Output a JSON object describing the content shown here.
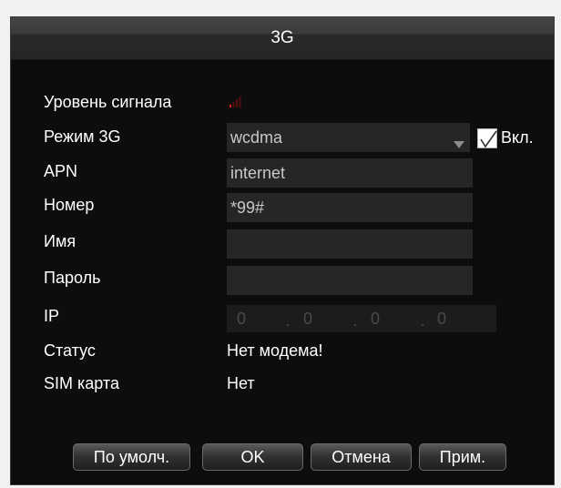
{
  "dialog": {
    "title": "3G"
  },
  "fields": {
    "signal_level": {
      "label": "Уровень сигнала",
      "icon": "signal-strength-icon",
      "level_bars_active": 1,
      "level_bars_total": 4,
      "color_active": "#e02020"
    },
    "mode_3g": {
      "label": "Режим 3G",
      "value": "wcdma",
      "enabled_label": "Вкл.",
      "enabled": true
    },
    "apn": {
      "label": "APN",
      "value": "internet"
    },
    "number": {
      "label": "Номер",
      "value": "*99#"
    },
    "name": {
      "label": "Имя",
      "value": ""
    },
    "password": {
      "label": "Пароль",
      "value": ""
    },
    "ip": {
      "label": "IP",
      "octets": [
        "0",
        "0",
        "0",
        "0"
      ],
      "separator": "."
    },
    "status": {
      "label": "Статус",
      "value": "Нет модема!"
    },
    "sim_card": {
      "label": "SIM карта",
      "value": "Нет"
    }
  },
  "buttons": {
    "default": "По умолч.",
    "ok": "OK",
    "cancel": "Отмена",
    "apply": "Прим."
  }
}
